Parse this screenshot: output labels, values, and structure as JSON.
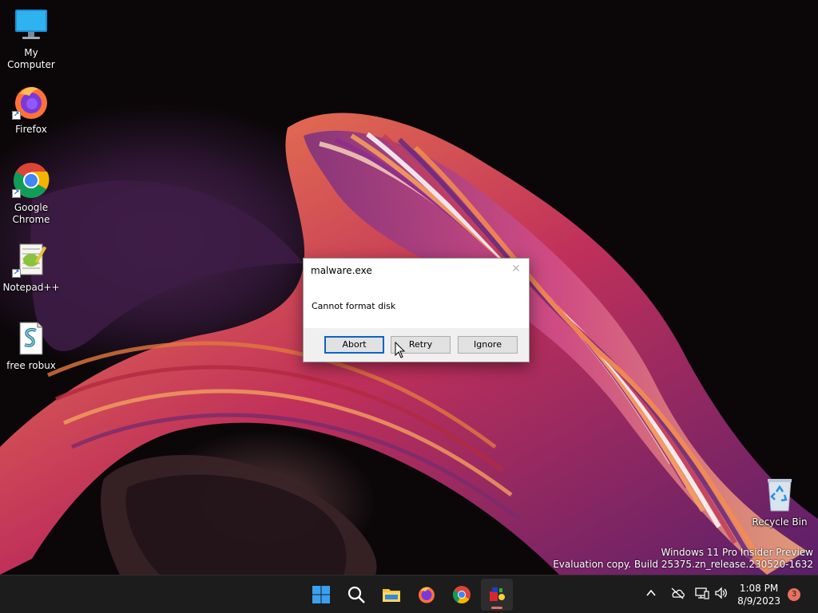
{
  "desktop": {
    "icons": [
      {
        "label": "My Computer",
        "icon": "monitor-icon"
      },
      {
        "label": "Firefox",
        "icon": "firefox-icon",
        "shortcut": true
      },
      {
        "label": "Google\nChrome",
        "label_line1": "Google",
        "label_line2": "Chrome",
        "icon": "chrome-icon",
        "shortcut": true
      },
      {
        "label": "Notepad++",
        "icon": "notepad-plus-plus-icon",
        "shortcut": true
      },
      {
        "label": "free robux",
        "icon": "script-file-icon"
      },
      {
        "label": "Recycle Bin",
        "icon": "recycle-bin-icon"
      }
    ]
  },
  "dialog": {
    "title": "malware.exe",
    "close_glyph": "✕",
    "message": "Cannot format disk",
    "buttons": {
      "abort": "Abort",
      "retry": "Retry",
      "ignore": "Ignore"
    },
    "default_button": "abort"
  },
  "watermark": {
    "line1": "Windows 11 Pro Insider Preview",
    "line2": "Evaluation copy. Build 25375.zn_release.230520-1632"
  },
  "taskbar": {
    "apps": [
      "start-icon",
      "search-icon",
      "file-explorer-icon",
      "firefox-icon",
      "chrome-icon",
      "running-app-icon"
    ],
    "active_app": "running-app-icon",
    "tray_icons": [
      "chevron-up-icon",
      "network-disconnected-icon",
      "display-icon",
      "speaker-icon"
    ],
    "clock": {
      "time": "1:08 PM",
      "date": "8/9/2023"
    },
    "notification_count": "3"
  },
  "colors": {
    "taskbar": "#1c1c1c",
    "dialog_default_border": "#0a64c8",
    "notification_badge": "#e9715f"
  }
}
